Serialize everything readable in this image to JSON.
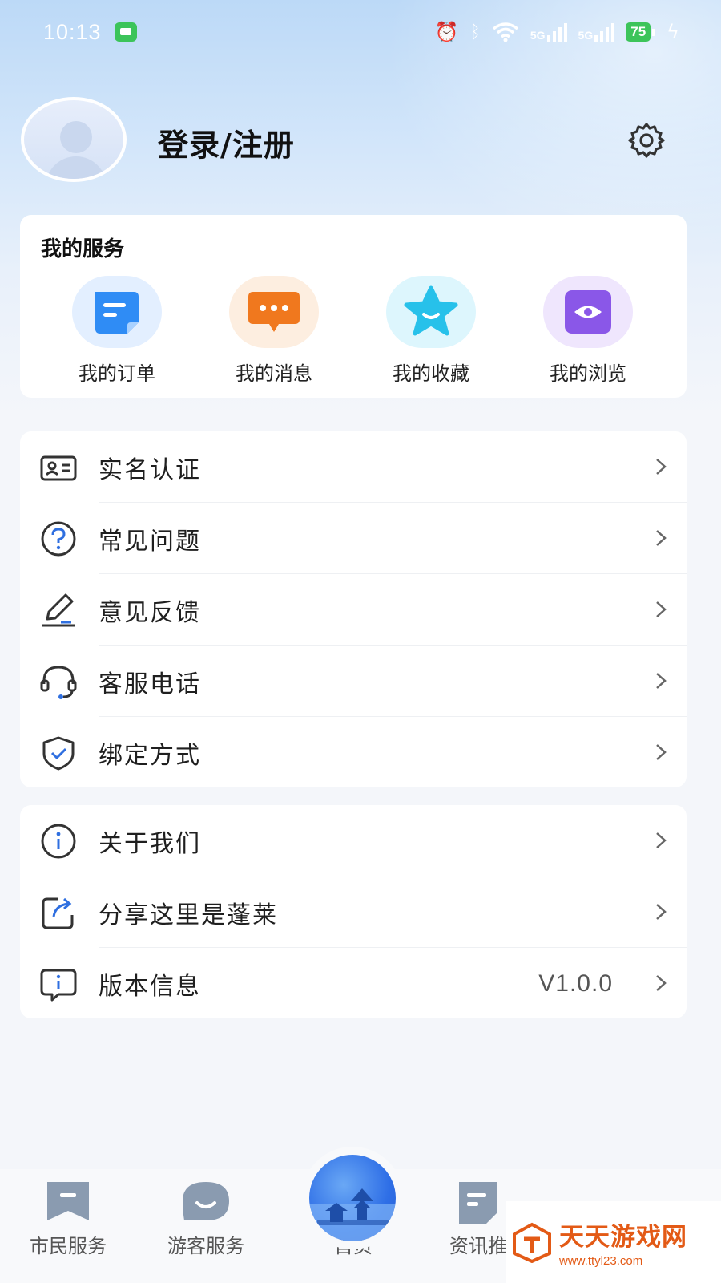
{
  "status_bar": {
    "time": "10:13",
    "signal_1": "5G",
    "signal_2": "5G",
    "battery": "75"
  },
  "profile": {
    "login_label": "登录/注册"
  },
  "services": {
    "title": "我的服务",
    "items": [
      {
        "label": "我的订单",
        "icon": "orders-icon",
        "color": "#2f8cf5"
      },
      {
        "label": "我的消息",
        "icon": "messages-icon",
        "color": "#f0781e"
      },
      {
        "label": "我的收藏",
        "icon": "favorites-star-icon",
        "color": "#27c1ea"
      },
      {
        "label": "我的浏览",
        "icon": "history-eye-icon",
        "color": "#8a57e8"
      }
    ]
  },
  "menu_group_1": [
    {
      "label": "实名认证",
      "icon": "id-card-icon"
    },
    {
      "label": "常见问题",
      "icon": "question-circle-icon"
    },
    {
      "label": "意见反馈",
      "icon": "pen-icon"
    },
    {
      "label": "客服电话",
      "icon": "headset-icon"
    },
    {
      "label": "绑定方式",
      "icon": "shield-check-icon"
    }
  ],
  "menu_group_2": [
    {
      "label": "关于我们",
      "icon": "info-circle-icon"
    },
    {
      "label": "分享这里是蓬莱",
      "icon": "share-icon"
    },
    {
      "label": "版本信息",
      "icon": "version-info-icon",
      "value": "V1.0.0"
    }
  ],
  "bottom_nav": {
    "items": [
      {
        "label": "市民服务",
        "icon": "bookmark-icon"
      },
      {
        "label": "游客服务",
        "icon": "smile-bubble-icon"
      },
      {
        "label": "首页",
        "icon": "home-pavilion-icon"
      },
      {
        "label": "资讯推",
        "icon": "news-doc-icon"
      }
    ]
  },
  "watermark": {
    "text": "天天游戏网",
    "url": "www.ttyl23.com"
  }
}
